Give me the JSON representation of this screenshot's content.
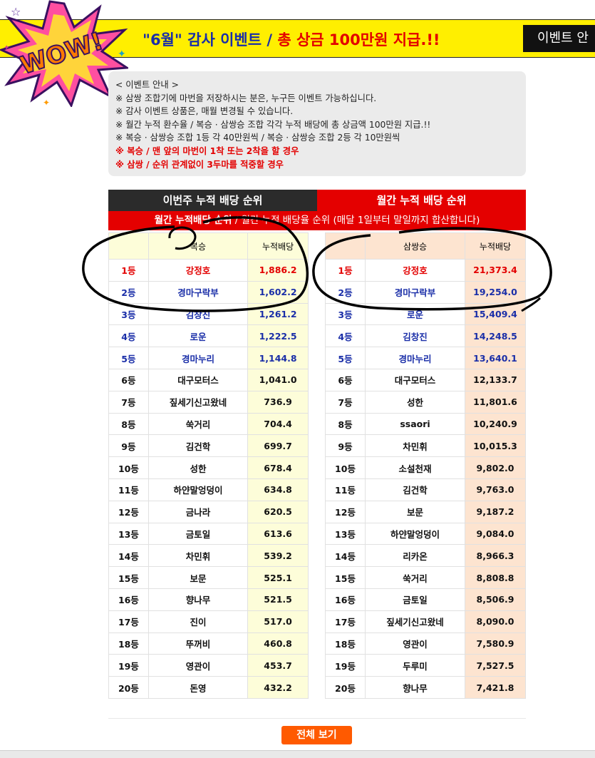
{
  "banner": {
    "logo_text": "WOW!",
    "title_part1": "\"6월\" 감사 이벤트 /",
    "title_part2": "총 상금 100만원 지급.!!",
    "button_label": "이벤트 안"
  },
  "info": {
    "lines": [
      "< 이벤트 안내 >",
      "※ 삼쌍 조합기에 마번을 저장하시는 분은, 누구든 이벤트 가능하십니다.",
      "※ 감사 이벤트 상품은, 매월 변경될 수 있습니다.",
      "※ 월간 누적 환수율 / 복승 · 삼쌍승 조합 각각 누적 배당에 총 상금액 100만원 지급.!!",
      "※ 복승 · 삼쌍승 조합 1등 각 40만원씩 / 복승 · 삼쌍승 조합 2등 각 10만원씩"
    ],
    "red_lines": [
      "※ 복승 / 맨 앞의 마번이 1착 또는 2착을 할 경우",
      "※ 삼쌍 / 순위 관계없이 3두마를 적중할 경우"
    ]
  },
  "tabs": {
    "weekly": "이번주 누적 배당 순위",
    "monthly": "월간 누적 배당 순위"
  },
  "subbar": {
    "bold": "월간 누적배당 순위",
    "rest": " / 월간 누적 배당율 순위 (매달 1일부터 말일까지 합산합니다)"
  },
  "table_left": {
    "headers": [
      "",
      "복승",
      "누적배당"
    ],
    "rows": [
      [
        "1등",
        "강정호",
        "1,886.2"
      ],
      [
        "2등",
        "경마구락부",
        "1,602.2"
      ],
      [
        "3등",
        "김창진",
        "1,261.2"
      ],
      [
        "4등",
        "로운",
        "1,222.5"
      ],
      [
        "5등",
        "경마누리",
        "1,144.8"
      ],
      [
        "6등",
        "대구모터스",
        "1,041.0"
      ],
      [
        "7등",
        "짚세기신고왔네",
        "736.9"
      ],
      [
        "8등",
        "쑥거리",
        "704.4"
      ],
      [
        "9등",
        "김건학",
        "699.7"
      ],
      [
        "10등",
        "성한",
        "678.4"
      ],
      [
        "11등",
        "하얀말엉덩이",
        "634.8"
      ],
      [
        "12등",
        "금나라",
        "620.5"
      ],
      [
        "13등",
        "금토일",
        "613.6"
      ],
      [
        "14등",
        "차민휘",
        "539.2"
      ],
      [
        "15등",
        "보문",
        "525.1"
      ],
      [
        "16등",
        "향나무",
        "521.5"
      ],
      [
        "17등",
        "진이",
        "517.0"
      ],
      [
        "18등",
        "뚜꺼비",
        "460.8"
      ],
      [
        "19등",
        "영관이",
        "453.7"
      ],
      [
        "20등",
        "돈영",
        "432.2"
      ]
    ]
  },
  "table_right": {
    "headers": [
      "",
      "삼쌍승",
      "누적배당"
    ],
    "rows": [
      [
        "1등",
        "강정호",
        "21,373.4"
      ],
      [
        "2등",
        "경마구락부",
        "19,254.0"
      ],
      [
        "3등",
        "로운",
        "15,409.4"
      ],
      [
        "4등",
        "김창진",
        "14,248.5"
      ],
      [
        "5등",
        "경마누리",
        "13,640.1"
      ],
      [
        "6등",
        "대구모터스",
        "12,133.7"
      ],
      [
        "7등",
        "성한",
        "11,801.6"
      ],
      [
        "8등",
        "ssaori",
        "10,240.9"
      ],
      [
        "9등",
        "차민휘",
        "10,015.3"
      ],
      [
        "10등",
        "소설천재",
        "9,802.0"
      ],
      [
        "11등",
        "김건학",
        "9,763.0"
      ],
      [
        "12등",
        "보문",
        "9,187.2"
      ],
      [
        "13등",
        "하얀말엉덩이",
        "9,084.0"
      ],
      [
        "14등",
        "리카온",
        "8,966.3"
      ],
      [
        "15등",
        "쑥거리",
        "8,808.8"
      ],
      [
        "16등",
        "금토일",
        "8,506.9"
      ],
      [
        "17등",
        "짚세기신고왔네",
        "8,090.0"
      ],
      [
        "18등",
        "영관이",
        "7,580.9"
      ],
      [
        "19등",
        "두루미",
        "7,527.5"
      ],
      [
        "20등",
        "향나무",
        "7,421.8"
      ]
    ]
  },
  "more_button": "전체 보기",
  "colors": {
    "banner_bg": "#ffef00",
    "accent_red": "#e40000",
    "title_blue": "#1a2ea8",
    "button_orange": "#ff5a00"
  }
}
